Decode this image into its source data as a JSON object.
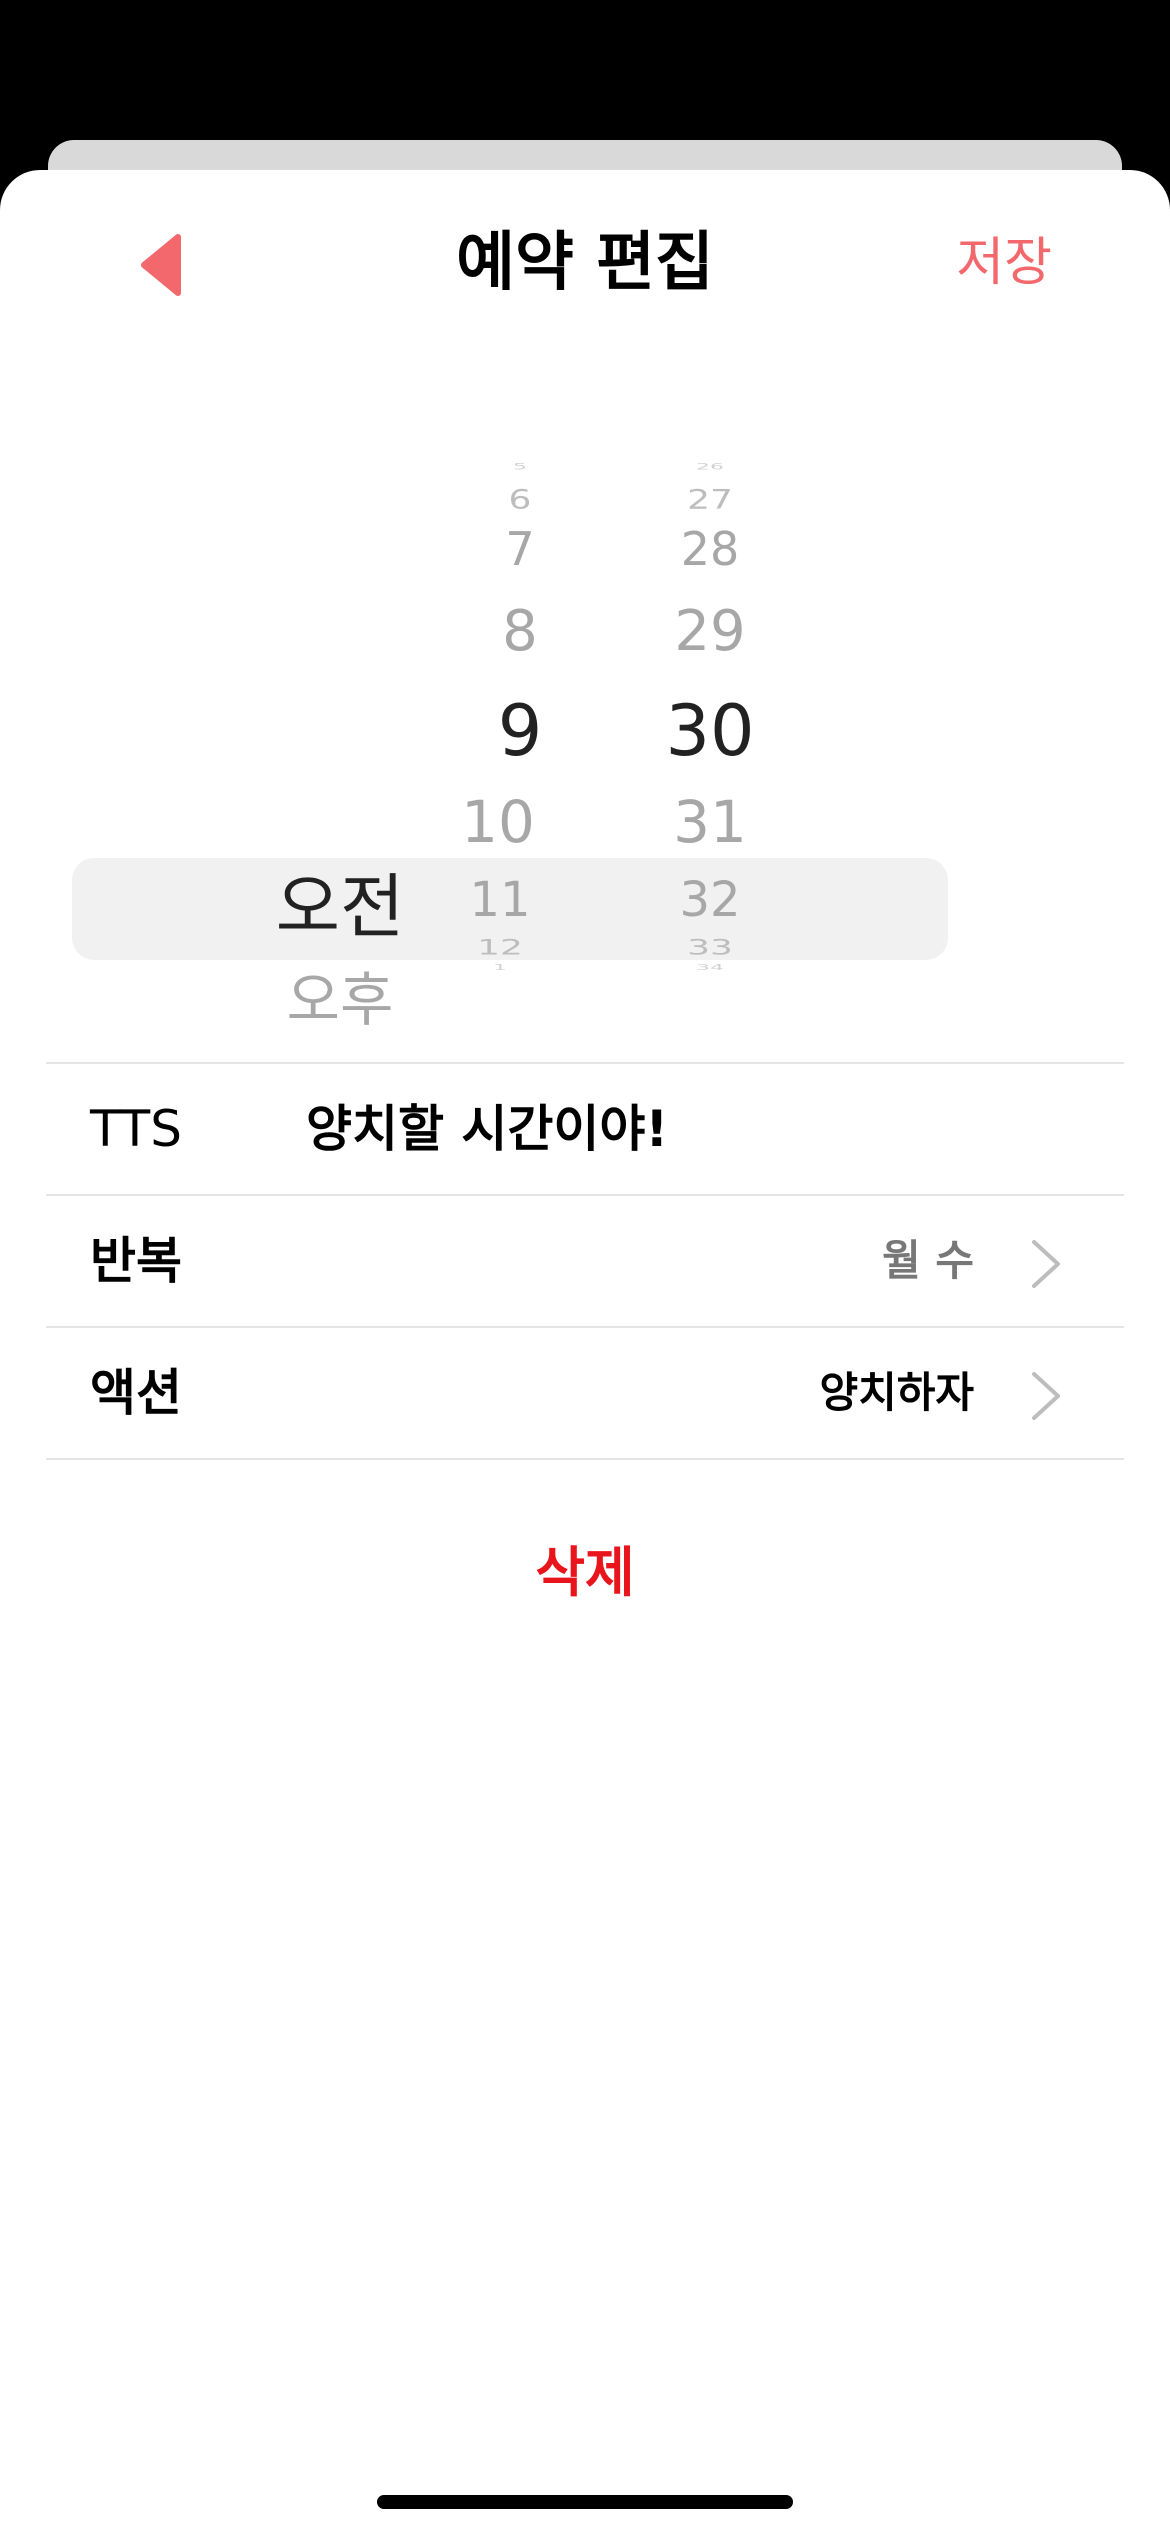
{
  "nav": {
    "title": "예약 편집",
    "save_label": "저장",
    "back_icon": "back-triangle-icon",
    "accent_color": "#f3686d"
  },
  "picker": {
    "ampm": {
      "options": [
        "오전",
        "오후"
      ],
      "selected": "오전"
    },
    "hours": {
      "visible": [
        "5",
        "6",
        "7",
        "8",
        "9",
        "10",
        "11",
        "12",
        "1"
      ],
      "selected": "9"
    },
    "minutes": {
      "visible": [
        "26",
        "27",
        "28",
        "29",
        "30",
        "31",
        "32",
        "33",
        "34"
      ],
      "selected": "30"
    }
  },
  "rows": {
    "tts": {
      "label": "TTS",
      "value": "양치할 시간이야!"
    },
    "repeat": {
      "label": "반복",
      "value": "월 수"
    },
    "action": {
      "label": "액션",
      "value": "양치하자"
    }
  },
  "delete_label": "삭제",
  "delete_color": "#e8151c"
}
